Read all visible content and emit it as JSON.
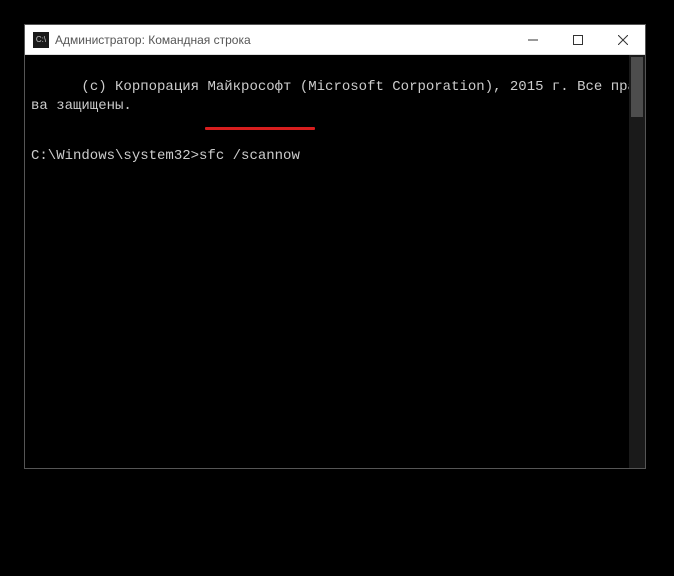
{
  "window": {
    "title": "Администратор: Командная строка",
    "icon_label": "C:\\"
  },
  "console": {
    "copyright_line": "(с) Корпорация Майкрософт (Microsoft Corporation), 2015 г. Все права защищены.",
    "prompt": "C:\\Windows\\system32>",
    "command": "sfc /scannow"
  },
  "annotations": {
    "underline_color": "#d81e1e"
  }
}
